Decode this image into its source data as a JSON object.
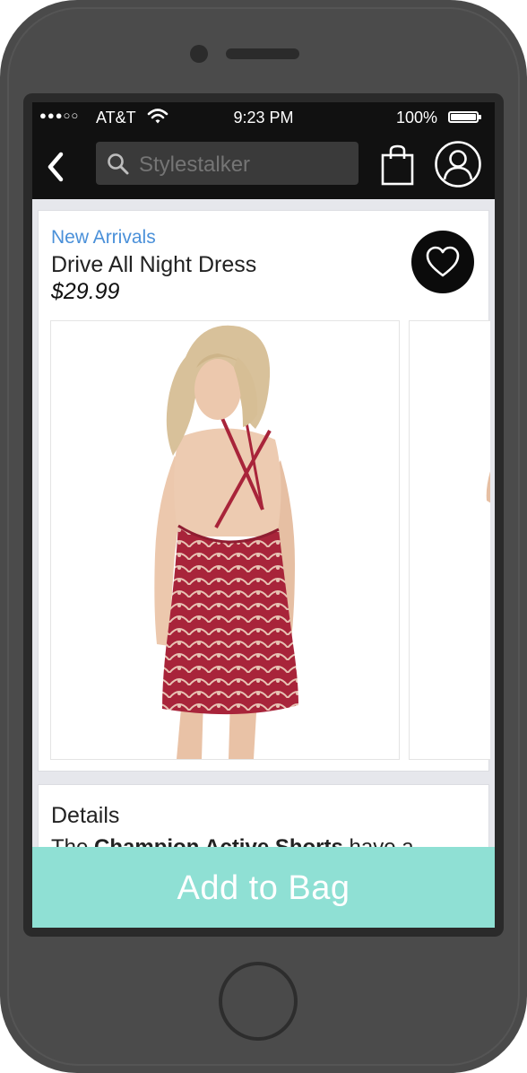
{
  "status_bar": {
    "signal": "●●●○○",
    "carrier": "AT&T",
    "time": "9:23 PM",
    "battery_percent": "100%",
    "battery_level": 1.0
  },
  "nav": {
    "search_placeholder": "Stylestalker",
    "icons": {
      "back": "chevron-left-icon",
      "search": "search-icon",
      "bag": "shopping-bag-icon",
      "account": "user-icon"
    }
  },
  "product": {
    "collection": "New Arrivals",
    "name": "Drive All Night Dress",
    "price": "$29.99",
    "favorite_icon": "heart-icon"
  },
  "details": {
    "heading": "Details",
    "text_prefix": "The ",
    "text_bold": "Champion Active Shorts",
    "text_suffix": " have a"
  },
  "cta": {
    "label": "Add to Bag"
  },
  "colors": {
    "accent_link": "#4a90d9",
    "cta_background": "#8fe0d4",
    "dress": "#a8243a",
    "nav_background": "#111111"
  }
}
